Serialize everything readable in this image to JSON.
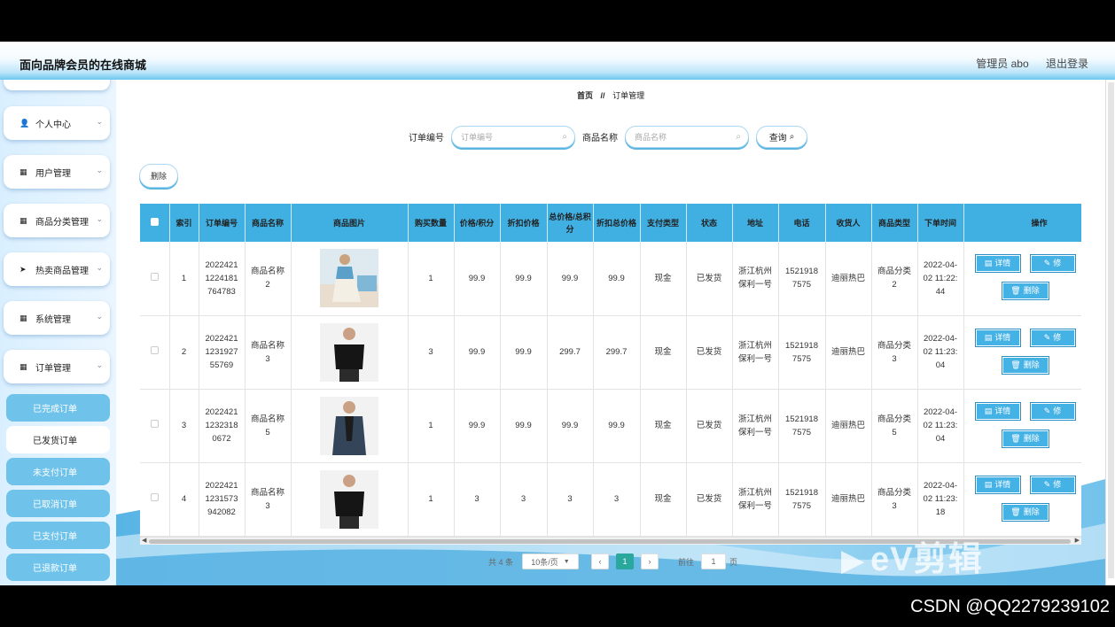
{
  "header": {
    "title": "面向品牌会员的在线商城",
    "user": "管理员 abo",
    "logout": "退出登录"
  },
  "sidebar": {
    "menus": [
      {
        "label": "个人中心",
        "icon": "person-icon"
      },
      {
        "label": "用户管理",
        "icon": "grid-icon"
      },
      {
        "label": "商品分类管理",
        "icon": "grid-icon"
      },
      {
        "label": "热卖商品管理",
        "icon": "send-icon"
      },
      {
        "label": "系统管理",
        "icon": "grid-icon"
      },
      {
        "label": "订单管理",
        "icon": "grid-icon"
      }
    ],
    "order_sub": [
      {
        "label": "已完成订单",
        "active": false
      },
      {
        "label": "已发货订单",
        "active": true
      },
      {
        "label": "未支付订单",
        "active": false
      },
      {
        "label": "已取消订单",
        "active": false
      },
      {
        "label": "已支付订单",
        "active": false
      },
      {
        "label": "已退款订单",
        "active": false
      }
    ]
  },
  "breadcrumb": {
    "home": "首页",
    "sep": "//",
    "current": "订单管理"
  },
  "search": {
    "order_label": "订单编号",
    "order_placeholder": "订单编号",
    "product_label": "商品名称",
    "product_placeholder": "商品名称",
    "query_label": "查询"
  },
  "delete_label": "删除",
  "table": {
    "headers": [
      "索引",
      "订单编号",
      "商品名称",
      "商品图片",
      "购买数量",
      "价格/积分",
      "折扣价格",
      "总价格/总积分",
      "折扣总价格",
      "支付类型",
      "状态",
      "地址",
      "电话",
      "收货人",
      "商品类型",
      "下单时间",
      "操作"
    ],
    "rows": [
      {
        "idx": "1",
        "order": "2022421 1224181 764783",
        "name": "商品名称2",
        "qty": "1",
        "price": "99.9",
        "disc": "99.9",
        "total": "99.9",
        "disc_total": "99.9",
        "pay": "现金",
        "status": "已发货",
        "addr": "浙江杭州保利一号",
        "phone": "1521918 7575",
        "receiver": "迪丽热巴",
        "type": "商品分类2",
        "time": "2022-04-02 11:22:44",
        "img": "woman"
      },
      {
        "idx": "2",
        "order": "2022421 1231927 55769",
        "name": "商品名称3",
        "qty": "3",
        "price": "99.9",
        "disc": "99.9",
        "total": "299.7",
        "disc_total": "299.7",
        "pay": "现金",
        "status": "已发货",
        "addr": "浙江杭州保利一号",
        "phone": "1521918 7575",
        "receiver": "迪丽热巴",
        "type": "商品分类3",
        "time": "2022-04-02 11:23:04",
        "img": "man-black"
      },
      {
        "idx": "3",
        "order": "2022421 1232318 0672",
        "name": "商品名称5",
        "qty": "1",
        "price": "99.9",
        "disc": "99.9",
        "total": "99.9",
        "disc_total": "99.9",
        "pay": "现金",
        "status": "已发货",
        "addr": "浙江杭州保利一号",
        "phone": "1521918 7575",
        "receiver": "迪丽热巴",
        "type": "商品分类5",
        "time": "2022-04-02 11:23:04",
        "img": "man-jacket"
      },
      {
        "idx": "4",
        "order": "2022421 1231573 942082",
        "name": "商品名称3",
        "qty": "1",
        "price": "3",
        "disc": "3",
        "total": "3",
        "disc_total": "3",
        "pay": "现金",
        "status": "已发货",
        "addr": "浙江杭州保利一号",
        "phone": "1521918 7575",
        "receiver": "迪丽热巴",
        "type": "商品分类3",
        "time": "2022-04-02 11:23:18",
        "img": "man-black"
      }
    ],
    "op_detail": "详情",
    "op_edit": "修",
    "op_delete": "删除"
  },
  "pagination": {
    "total": "共 4 条",
    "page_size": "10条/页",
    "current": "1",
    "goto": "前往",
    "goto_value": "1",
    "page_unit": "页"
  },
  "watermark": "eV剪辑",
  "credit": "CSDN @QQ2279239102",
  "colors": {
    "accent": "#40b0e3",
    "page_active": "#2ba89e"
  }
}
